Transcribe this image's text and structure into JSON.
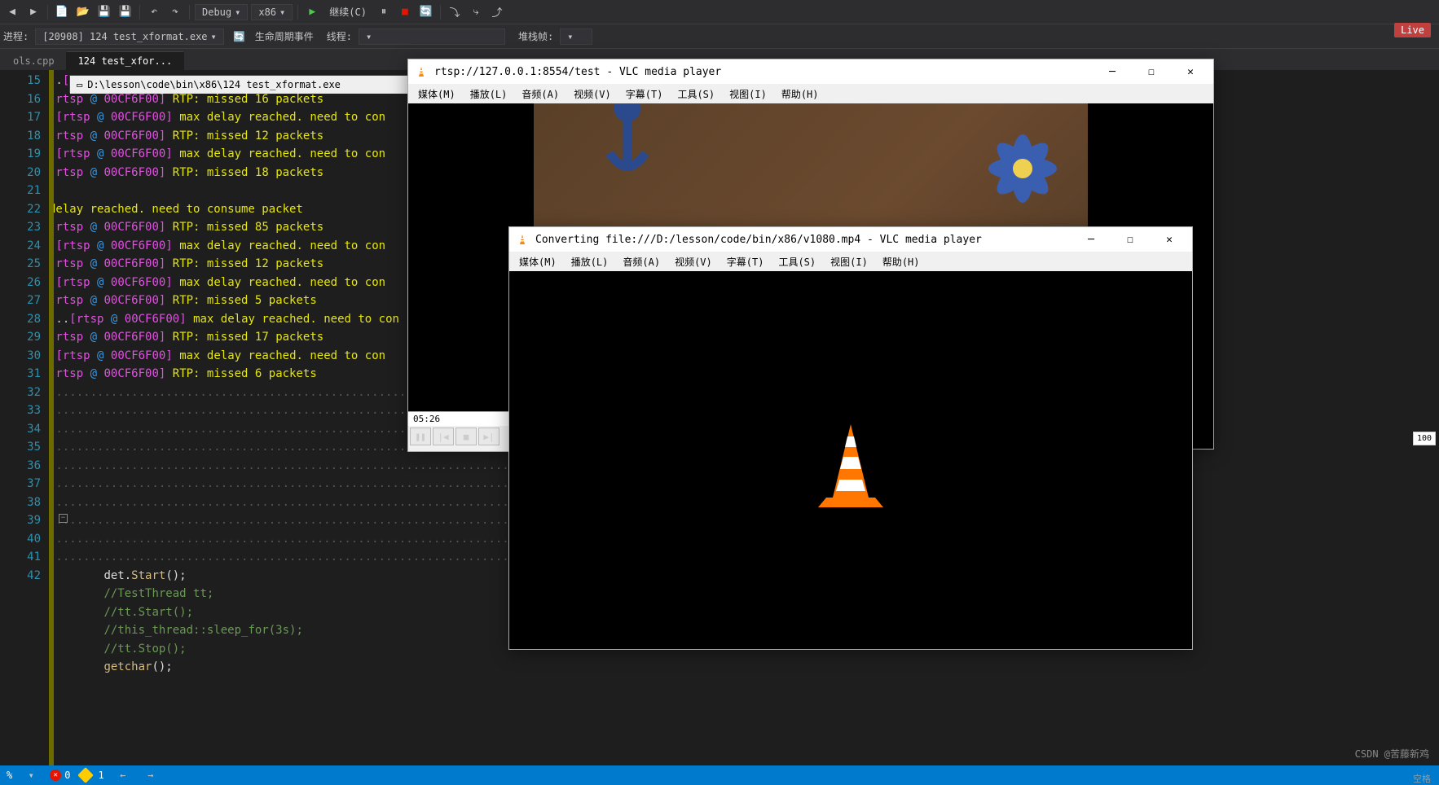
{
  "toolbar": {
    "config": "Debug",
    "platform": "x86",
    "continue": "继续(C)",
    "live": "Live"
  },
  "debugbar": {
    "process_label": "进程:",
    "process": "[20908] 124 test_xformat.exe",
    "lifecycle": "生命周期事件",
    "thread_label": "线程:",
    "stackframe": "堆栈帧:"
  },
  "tabs": {
    "t1": "ols.cpp",
    "t2": "124 test_xfor..."
  },
  "lines": {
    "start": 15,
    "end": 42
  },
  "console": {
    "title": "D:\\lesson\\code\\bin\\x86\\124 test_xformat.exe",
    "tag": "rtsp",
    "addr": "00CF6F00",
    "msg_delay": "max delay reached. need to con",
    "msg_delay_full": "delay reached. need to consume packet",
    "rtp": "RTP: missed",
    "packets": "packets",
    "n15": "16",
    "n17": "12",
    "n19": "18",
    "n21": "85",
    "n23": "12",
    "n25": "5",
    "n27": "17",
    "n29": "6"
  },
  "code": {
    "l37": "det.Start();",
    "l38": "//TestThread tt;",
    "l39": "//tt.Start();",
    "l40": "//this_thread::sleep_for(3s);",
    "l41": "//tt.Stop();",
    "l42": "getchar();"
  },
  "vlc1": {
    "title": "rtsp://127.0.0.1:8554/test - VLC media player",
    "menu": {
      "media": "媒体(M)",
      "play": "播放(L)",
      "audio": "音频(A)",
      "video": "视频(V)",
      "subtitle": "字幕(T)",
      "tools": "工具(S)",
      "view": "视图(I)",
      "help": "帮助(H)"
    },
    "time": "05:26"
  },
  "vlc2": {
    "title": "Converting file:///D:/lesson/code/bin/x86/v1080.mp4 - VLC media player",
    "menu": {
      "media": "媒体(M)",
      "play": "播放(L)",
      "audio": "音频(A)",
      "video": "视频(V)",
      "subtitle": "字幕(T)",
      "tools": "工具(S)",
      "view": "视图(I)",
      "help": "帮助(H)"
    },
    "volume": "100"
  },
  "status": {
    "errors": "0",
    "warnings": "1",
    "percent": "%",
    "space": "空格"
  },
  "watermark": "CSDN @苦藤新鸡"
}
